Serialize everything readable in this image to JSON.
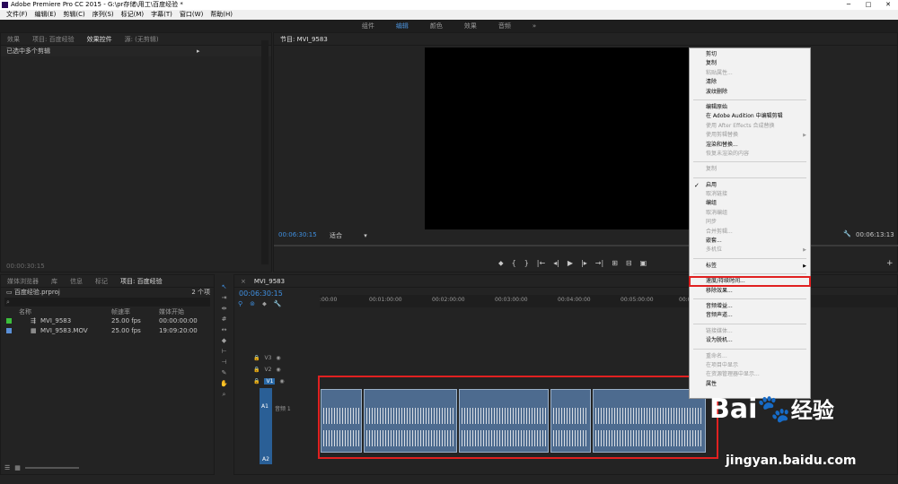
{
  "window": {
    "title": "Adobe Premiere Pro CC 2015 - G:\\pr存储\\用工\\百度经验 *",
    "controls": [
      "─",
      "□",
      "✕"
    ]
  },
  "menubar": [
    "文件(F)",
    "编辑(E)",
    "剪辑(C)",
    "序列(S)",
    "标记(M)",
    "字幕(T)",
    "窗口(W)",
    "帮助(H)"
  ],
  "workspaces": {
    "items": [
      "组件",
      "编辑",
      "颜色",
      "效果",
      "音频"
    ],
    "active": "编辑",
    "more": "»"
  },
  "source_panel": {
    "tabs": [
      "效果",
      "项目: 百度经验",
      "效果控件",
      "源: (无剪辑)"
    ],
    "active_tab": "效果控件",
    "status": "已选中多个剪辑",
    "timecode": "00:00:30:15"
  },
  "program_monitor": {
    "title": "节目: MVI_9583",
    "timecode": "00:06:30:15",
    "fit": "适合",
    "duration": "00:06:13:13"
  },
  "project_panel": {
    "tabs": [
      "媒体浏览器",
      "库",
      "信息",
      "标记",
      "项目: 百度经验"
    ],
    "file": "百度经验.prproj",
    "count": "2 个项",
    "columns": [
      "名称",
      "帧速率",
      "媒体开始"
    ],
    "rows": [
      {
        "name": "MVI_9583",
        "rate": "25.00 fps",
        "start": "00:00:00:00",
        "color": "#3cbf3c"
      },
      {
        "name": "MVI_9583.MOV",
        "rate": "25.00 fps",
        "start": "19:09:20:00",
        "color": "#5a8fd6"
      }
    ]
  },
  "timeline": {
    "tab": "MVI_9583",
    "timecode": "00:06:30:15",
    "ruler": [
      ":00:00",
      "00:01:00:00",
      "00:02:00:00",
      "00:03:00:00",
      "00:04:00:00",
      "00:05:00:00",
      "00:06:00"
    ],
    "tracks": [
      "V3",
      "V2",
      "V1",
      "A1",
      "A2"
    ],
    "a1_label": "音频 1"
  },
  "context_menu": [
    {
      "label": "剪切",
      "enabled": true
    },
    {
      "label": "复制",
      "enabled": true
    },
    {
      "label": "粘贴属性...",
      "enabled": false
    },
    {
      "label": "清除",
      "enabled": true
    },
    {
      "label": "波纹删除",
      "enabled": true
    },
    {
      "sep": true
    },
    {
      "label": "编辑原始",
      "enabled": true
    },
    {
      "label": "在 Adobe Audition 中编辑剪辑",
      "enabled": true
    },
    {
      "label": "使用 After Effects 合成替换",
      "enabled": false
    },
    {
      "label": "使用剪辑替换",
      "enabled": false,
      "submenu": true
    },
    {
      "label": "渲染和替换...",
      "enabled": true
    },
    {
      "label": "恢复未渲染的内容",
      "enabled": false
    },
    {
      "sep": true
    },
    {
      "label": "复制",
      "enabled": false
    },
    {
      "sep": true
    },
    {
      "label": "启用",
      "enabled": true,
      "checked": true
    },
    {
      "label": "取消链接",
      "enabled": false
    },
    {
      "label": "编组",
      "enabled": true
    },
    {
      "label": "取消编组",
      "enabled": false
    },
    {
      "label": "同步",
      "enabled": false
    },
    {
      "label": "合并剪辑...",
      "enabled": false
    },
    {
      "label": "嵌套...",
      "enabled": true
    },
    {
      "label": "多机位",
      "enabled": false,
      "submenu": true
    },
    {
      "sep": true
    },
    {
      "label": "标签",
      "enabled": true,
      "submenu": true
    },
    {
      "sep": true
    },
    {
      "label": "速度/持续时间...",
      "enabled": true,
      "highlight": true
    },
    {
      "label": "移除效果...",
      "enabled": true
    },
    {
      "sep": true
    },
    {
      "label": "音频增益...",
      "enabled": true
    },
    {
      "label": "音频声道...",
      "enabled": true
    },
    {
      "sep": true
    },
    {
      "label": "链接媒体...",
      "enabled": false
    },
    {
      "label": "设为脱机...",
      "enabled": true
    },
    {
      "sep": true
    },
    {
      "label": "重命名...",
      "enabled": false
    },
    {
      "label": "在项目中显示",
      "enabled": false
    },
    {
      "label": "在资源管理器中显示...",
      "enabled": false
    },
    {
      "label": "属性",
      "enabled": true
    }
  ],
  "watermark": {
    "brand": "Bai",
    "paw": "du",
    "cn": "经验",
    "url": "jingyan.baidu.com"
  }
}
